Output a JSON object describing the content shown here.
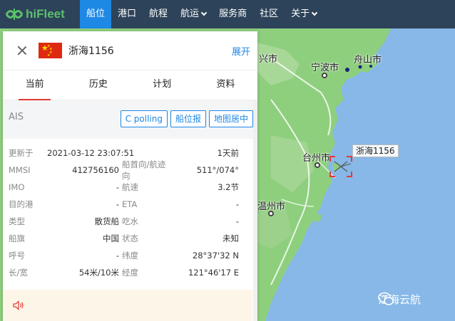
{
  "brand": {
    "name": "hiFleet",
    "color": "#5cc06a"
  },
  "nav": [
    {
      "label": "船位",
      "active": true,
      "dropdown": false
    },
    {
      "label": "港口",
      "active": false,
      "dropdown": false
    },
    {
      "label": "航程",
      "active": false,
      "dropdown": false
    },
    {
      "label": "航运",
      "active": false,
      "dropdown": true
    },
    {
      "label": "服务商",
      "active": false,
      "dropdown": false
    },
    {
      "label": "社区",
      "active": false,
      "dropdown": false
    },
    {
      "label": "关于",
      "active": false,
      "dropdown": true
    }
  ],
  "panel": {
    "ship_name": "浙海1156",
    "expand_label": "展开",
    "flag": "china-flag",
    "tabs": [
      "当前",
      "历史",
      "计划",
      "资料"
    ],
    "active_tab": "当前",
    "ais_label": "AIS",
    "buttons": [
      "C polling",
      "船位报",
      "地图居中"
    ],
    "rows": [
      {
        "k1": "更新于",
        "v1": "2021-03-12 23:07:51",
        "k2": "",
        "v2": "1天前"
      },
      {
        "k1": "MMSI",
        "v1": "412756160",
        "k2": "船首向/航迹向",
        "v2": "511°/074°"
      },
      {
        "k1": "IMO",
        "v1": "-",
        "k2": "航速",
        "v2": "3.2节"
      },
      {
        "k1": "目的港",
        "v1": "-",
        "k2": "ETA",
        "v2": "-"
      },
      {
        "k1": "类型",
        "v1": "散货船",
        "k2": "吃水",
        "v2": "-"
      },
      {
        "k1": "船旗",
        "v1": "中国",
        "k2": "状态",
        "v2": "未知"
      },
      {
        "k1": "呼号",
        "v1": "-",
        "k2": "纬度",
        "v2": "28°37'32 N"
      },
      {
        "k1": "长/宽",
        "v1": "54米/10米",
        "k2": "经度",
        "v2": "121°46'17 E"
      }
    ]
  },
  "map": {
    "cities": [
      "兴市",
      "宁波市",
      "舟山市",
      "台州市",
      "温州市"
    ],
    "vessel_label": "浙海1156",
    "watermark": "江海云航"
  },
  "colors": {
    "nav_bg": "#2d4359",
    "accent": "#1e88e5",
    "tab_underline": "#e53935",
    "sea": "#87b8e8",
    "land": "#8ecf7e"
  }
}
